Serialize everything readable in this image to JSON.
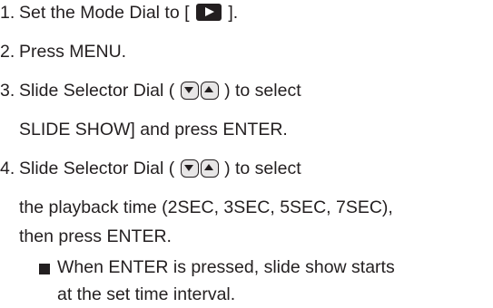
{
  "steps": [
    {
      "number": "1.",
      "prefix": "Set the Mode Dial to [",
      "icon": "playback-icon",
      "suffix": "]."
    },
    {
      "number": "2.",
      "text": "Press MENU."
    },
    {
      "number": "3.",
      "prefix": "Slide Selector Dial (",
      "icons": [
        "down-arrow-icon",
        "up-arrow-icon"
      ],
      "suffix": ") to select",
      "continuation": "SLIDE SHOW] and press ENTER."
    },
    {
      "number": "4.",
      "prefix": "Slide Selector Dial (",
      "icons": [
        "down-arrow-icon",
        "up-arrow-icon"
      ],
      "suffix": ") to select",
      "continuation_1": "the playback time (2SEC, 3SEC, 5SEC, 7SEC),",
      "continuation_2": "then press ENTER."
    }
  ],
  "note": {
    "bullet_icon": "square-bullet-icon",
    "line_1": "When ENTER is pressed, slide show starts",
    "line_2": "at the set time interval."
  },
  "colors": {
    "text": "#231f20",
    "icon_fill": "#231f20",
    "dial_background": "#e7e6e6",
    "page_background": "#ffffff"
  }
}
